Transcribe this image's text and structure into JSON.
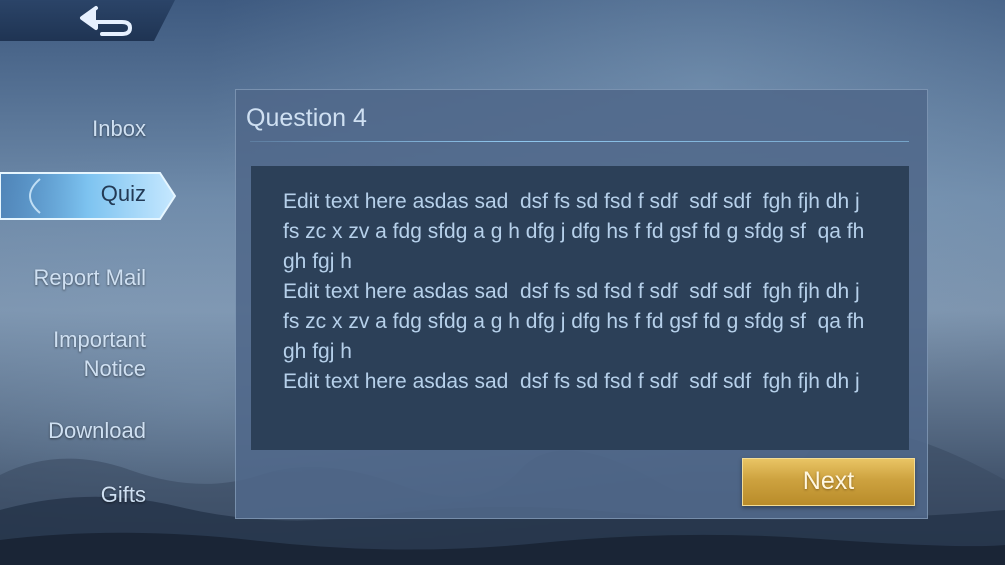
{
  "nav": {
    "back_icon": "back-arrow-icon",
    "items": [
      {
        "label": "Inbox"
      },
      {
        "label": "Quiz",
        "active": true
      },
      {
        "label": "Report Mail"
      },
      {
        "label": "Important\nNotice"
      },
      {
        "label": "Download"
      },
      {
        "label": "Gifts"
      }
    ]
  },
  "question": {
    "title": "Question 4",
    "text": "Edit text here asdas sad  dsf fs sd fsd f sdf  sdf sdf  fgh fjh dh j fs zc x zv a fdg sfdg a g h dfg j dfg hs f fd gsf fd g sfdg sf  qa fh gh fgj h\nEdit text here asdas sad  dsf fs sd fsd f sdf  sdf sdf  fgh fjh dh j fs zc x zv a fdg sfdg a g h dfg j dfg hs f fd gsf fd g sfdg sf  qa fh gh fgj h\nEdit text here asdas sad  dsf fs sd fsd f sdf  sdf sdf  fgh fjh dh j",
    "next_label": "Next"
  },
  "colors": {
    "accent_gold": "#cda23f",
    "text_light": "#cfe0f2",
    "question_bg": "#2c4058"
  }
}
